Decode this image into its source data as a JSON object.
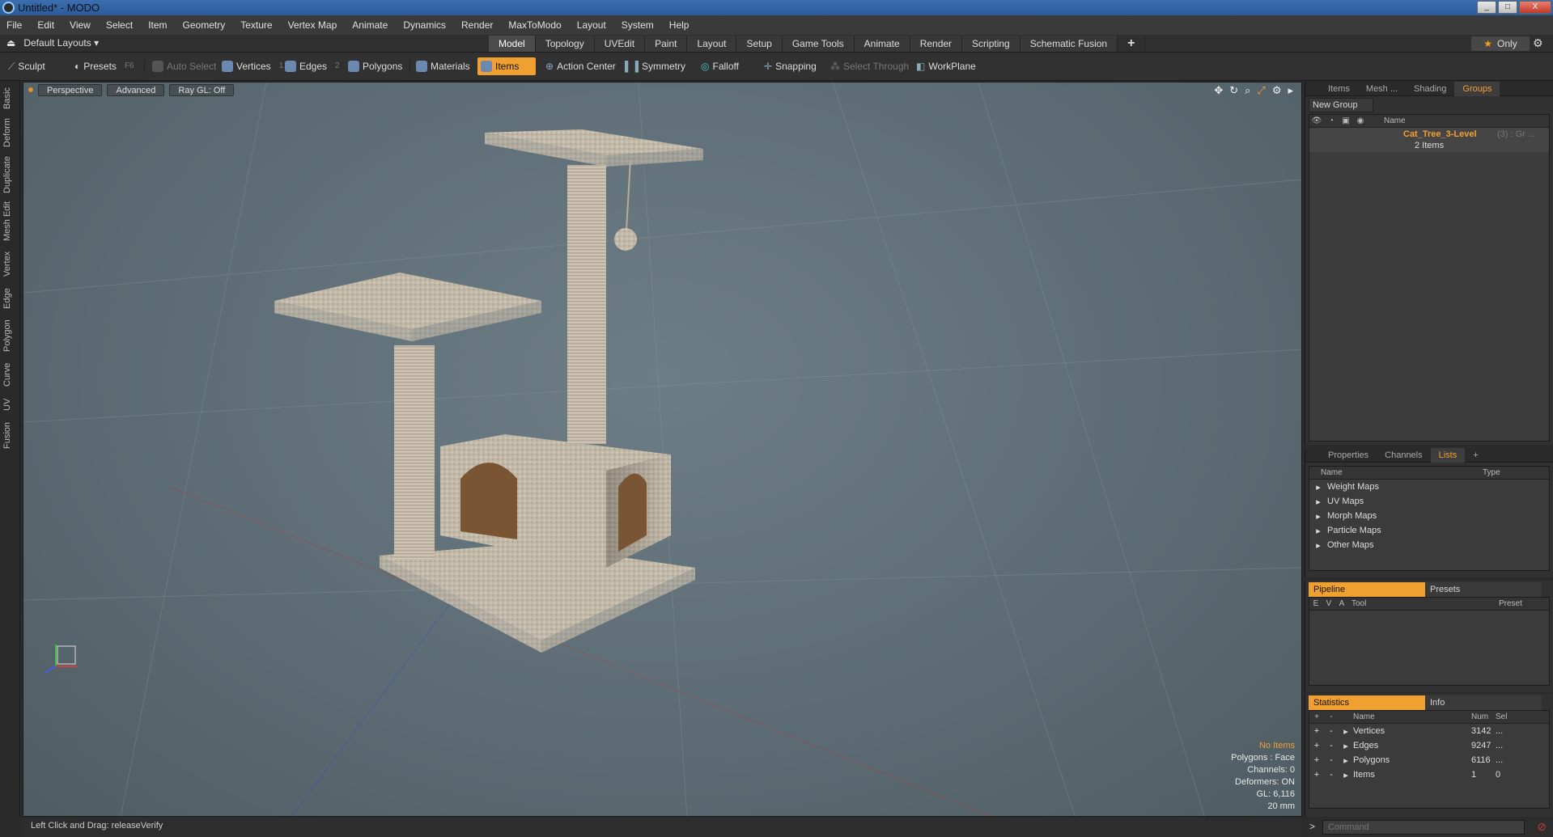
{
  "window": {
    "title": "Untitled* - MODO",
    "min": "_",
    "max": "□",
    "close": "X"
  },
  "menu": [
    "File",
    "Edit",
    "View",
    "Select",
    "Item",
    "Geometry",
    "Texture",
    "Vertex Map",
    "Animate",
    "Dynamics",
    "Render",
    "MaxToModo",
    "Layout",
    "System",
    "Help"
  ],
  "layouts": {
    "label": "Default Layouts ▾"
  },
  "tabs": [
    "Model",
    "Topology",
    "UVEdit",
    "Paint",
    "Layout",
    "Setup",
    "Game Tools",
    "Animate",
    "Render",
    "Scripting",
    "Schematic Fusion",
    "+"
  ],
  "only_label": "Only",
  "toolbar": {
    "sculpt": "Sculpt",
    "presets": "Presets",
    "presets_key": "F6",
    "auto_select": "Auto Select",
    "vertices": "Vertices",
    "vertices_key": "1",
    "edges": "Edges",
    "edges_key": "2",
    "polygons": "Polygons",
    "materials": "Materials",
    "items": "Items",
    "action_center": "Action Center",
    "symmetry": "Symmetry",
    "falloff": "Falloff",
    "snapping": "Snapping",
    "select_through": "Select Through",
    "workplane": "WorkPlane"
  },
  "left_tabs": [
    "Basic",
    "Deform",
    "Duplicate",
    "Mesh Edit",
    "Vertex",
    "Edge",
    "Polygon",
    "Curve",
    "UV",
    "Fusion"
  ],
  "viewport": {
    "perspective": "Perspective",
    "advanced": "Advanced",
    "raygl": "Ray GL: Off",
    "stats": {
      "no_items": "No Items",
      "polygons": "Polygons : Face",
      "channels": "Channels: 0",
      "deformers": "Deformers: ON",
      "gl": "GL: 6,116",
      "scale": "20 mm"
    }
  },
  "status": "Left Click and Drag:   releaseVerify",
  "groups_panel": {
    "tabs": [
      "Items",
      "Mesh ...",
      "Shading",
      "Groups"
    ],
    "new_group": "New Group",
    "col_name": "Name",
    "group_name": "Cat_Tree_3-Level",
    "group_suffix": "(3) : Gr ...",
    "group_items": "2 Items"
  },
  "lists_panel": {
    "tabs": [
      "Properties",
      "Channels",
      "Lists",
      "+"
    ],
    "col_name": "Name",
    "col_type": "Type",
    "rows": [
      "Weight Maps",
      "UV Maps",
      "Morph Maps",
      "Particle Maps",
      "Other Maps"
    ]
  },
  "pipeline_panel": {
    "tabs": [
      "Pipeline",
      "Presets"
    ],
    "cols": [
      "E",
      "V",
      "A",
      "Tool",
      "Preset"
    ]
  },
  "stats_panel": {
    "tabs": [
      "Statistics",
      "Info"
    ],
    "cols": [
      "+",
      "-",
      "Name",
      "Num",
      "Sel"
    ],
    "rows": [
      {
        "name": "Vertices",
        "num": "3142",
        "sel": "..."
      },
      {
        "name": "Edges",
        "num": "9247",
        "sel": "..."
      },
      {
        "name": "Polygons",
        "num": "6116",
        "sel": "..."
      },
      {
        "name": "Items",
        "num": "1",
        "sel": "0"
      }
    ]
  },
  "command": {
    "placeholder": "Command"
  },
  "colors": {
    "accent": "#f0a030",
    "viewport_bg": "#5f6e76",
    "carpet": "#c7bdae"
  }
}
